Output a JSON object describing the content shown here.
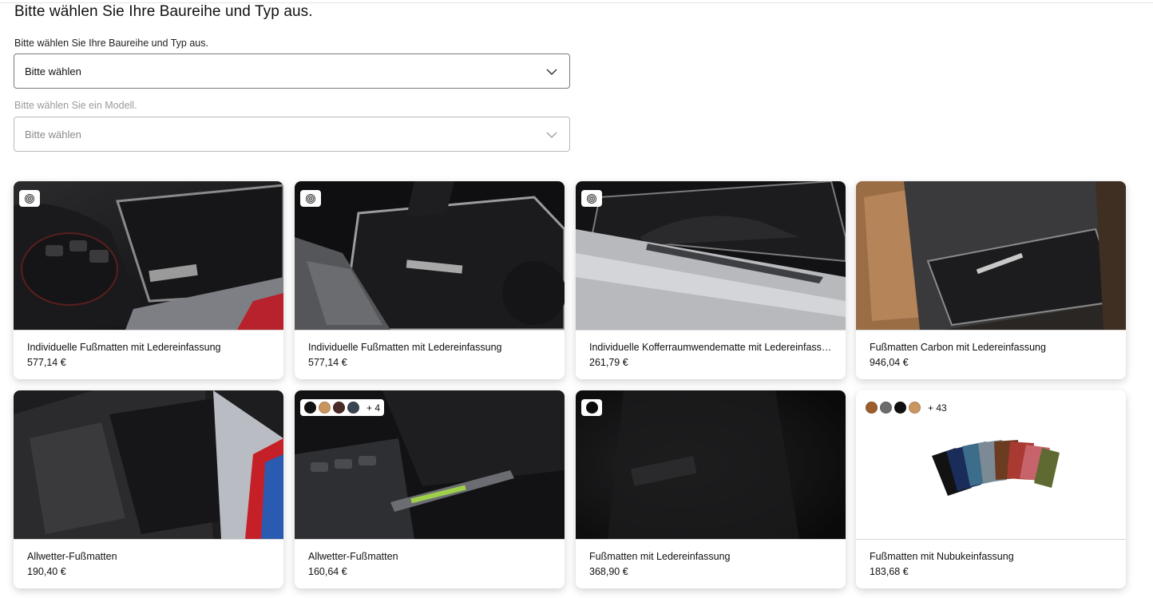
{
  "header": {
    "title": "Bitte wählen Sie Ihre Baureihe und Typ aus."
  },
  "selectors": {
    "series": {
      "label": "Bitte wählen Sie Ihre Baureihe und Typ aus.",
      "value": "Bitte wählen"
    },
    "model": {
      "label": "Bitte wählen Sie ein Modell.",
      "value": "Bitte wählen",
      "disabled": true
    }
  },
  "products": [
    {
      "name": "Individuelle Fußmatten mit Ledereinfassung",
      "price": "577,14 €",
      "badge": "configurator-icon"
    },
    {
      "name": "Individuelle Fußmatten mit Ledereinfassung",
      "price": "577,14 €",
      "badge": "configurator-icon"
    },
    {
      "name": "Individuelle Kofferraumwendematte mit Ledereinfassung für Cayenne",
      "price": "261,79 €",
      "badge": "configurator-icon"
    },
    {
      "name": "Fußmatten Carbon mit Ledereinfassung",
      "price": "946,04 €"
    },
    {
      "name": "Allwetter-Fußmatten",
      "price": "190,40 €"
    },
    {
      "name": "Allwetter-Fußmatten",
      "price": "160,64 €",
      "swatches": [
        "#111111",
        "#c8955e",
        "#4a2a26",
        "#3b4552"
      ],
      "more": "+ 4"
    },
    {
      "name": "Fußmatten mit Ledereinfassung",
      "price": "368,90 €",
      "swatches": [
        "#0b0b0b"
      ]
    },
    {
      "name": "Fußmatten mit Nubukeinfassung",
      "price": "183,68 €",
      "swatches": [
        "#9b5e2c",
        "#6c6c6c",
        "#0f0f0f",
        "#c99662"
      ],
      "more": "+ 43"
    }
  ],
  "colors": {
    "border": "#7a7a7a",
    "border_disabled": "#b9b9b9",
    "text": "#111111",
    "muted": "#9a9a9a"
  }
}
